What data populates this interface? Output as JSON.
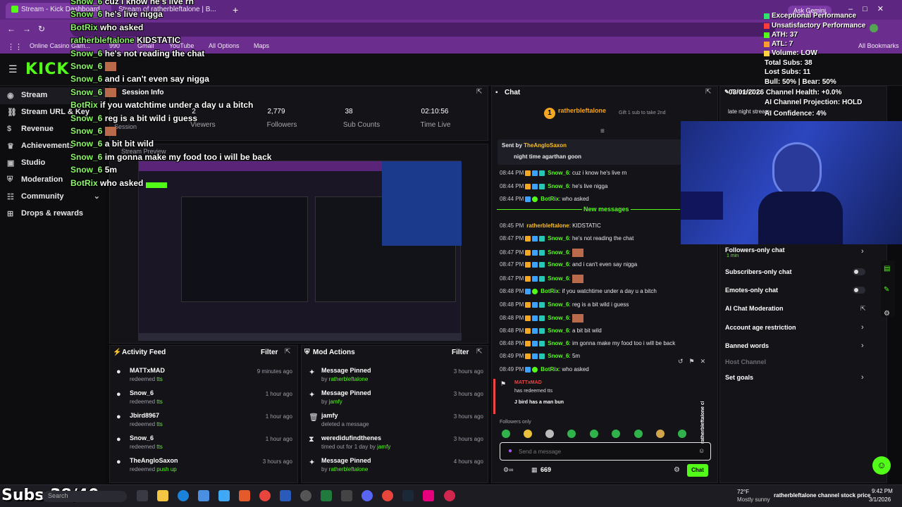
{
  "browser": {
    "tab_title": "Stream - Kick Dashboard",
    "tab2_title": "Stream of ratherbleftalone | B...",
    "ask_gemini": "Ask Gemini",
    "bookmarks": [
      "Online Casino Gam...",
      "990",
      "Gmail",
      "YouTube",
      "All Options",
      "Maps"
    ],
    "all_bookmarks": "All Bookmarks"
  },
  "sidebar": {
    "items": [
      {
        "label": "Stream",
        "icon": "broadcast-icon"
      },
      {
        "label": "Stream URL & Key",
        "icon": "link-icon"
      },
      {
        "label": "Revenue",
        "icon": "dollar-icon"
      },
      {
        "label": "Achievements",
        "icon": "trophy-icon"
      },
      {
        "label": "Studio",
        "icon": "studio-icon"
      },
      {
        "label": "Moderation",
        "icon": "shield-icon"
      },
      {
        "label": "Community",
        "icon": "community-icon"
      },
      {
        "label": "Drops & rewards",
        "icon": "gift-icon"
      }
    ]
  },
  "session": {
    "title": "Session Info",
    "stats": [
      {
        "value": "2",
        "label": "Viewers"
      },
      {
        "value": "2,779",
        "label": "Followers"
      },
      {
        "value": "38",
        "label": "Sub Counts"
      },
      {
        "value": "02:10:56",
        "label": "Time Live"
      }
    ],
    "session_label": "Session",
    "preview_label": "Stream Preview"
  },
  "activity": {
    "title": "Activity Feed",
    "filter": "Filter",
    "items": [
      {
        "name": "MATTxMAD",
        "action": "redeemed",
        "what": "tts",
        "time": "9 minutes ago"
      },
      {
        "name": "Snow_6",
        "action": "redeemed",
        "what": "tts",
        "time": "1 hour ago"
      },
      {
        "name": "Jbird8967",
        "action": "redeemed",
        "what": "tts",
        "time": "1 hour ago"
      },
      {
        "name": "Snow_6",
        "action": "redeemed",
        "what": "tts",
        "time": "1 hour ago"
      },
      {
        "name": "TheAngloSaxon",
        "action": "redeemed",
        "what": "push up",
        "time": "3 hours ago"
      }
    ]
  },
  "mod_actions": {
    "title": "Mod Actions",
    "filter": "Filter",
    "items": [
      {
        "title": "Message Pinned",
        "by": "by",
        "who": "ratherbleftalone",
        "time": "3 hours ago",
        "icon": "pin-icon"
      },
      {
        "title": "Message Pinned",
        "by": "by",
        "who": "jamfy",
        "time": "3 hours ago",
        "icon": "pin-icon"
      },
      {
        "title": "jamfy",
        "by": "deleted a message",
        "who": "",
        "time": "3 hours ago",
        "icon": "trash-icon"
      },
      {
        "title": "weredidufindthenes",
        "by": "timed out for 1 day by",
        "who": "jamfy",
        "time": "3 hours ago",
        "icon": "hourglass-icon"
      },
      {
        "title": "Message Pinned",
        "by": "by",
        "who": "ratherbleftalone",
        "time": "4 hours ago",
        "icon": "pin-icon"
      }
    ]
  },
  "chat": {
    "title": "Chat",
    "streamer": "ratherbleftalone",
    "gift_text": "Gift 1 sub to take 2nd",
    "sent_by": "Sent by",
    "sent_user": "TheAngloSaxon",
    "pinned": "night time agarthan goon",
    "new_messages": "New messages",
    "messages": [
      {
        "time": "08:44 PM",
        "user": "Snow_6",
        "text": "cuz i know he's live rn",
        "kind": "snow"
      },
      {
        "time": "08:44 PM",
        "user": "Snow_6",
        "text": "he's live nigga",
        "kind": "snow"
      },
      {
        "time": "08:44 PM",
        "user": "BotRix",
        "text": "who asked",
        "kind": "bot"
      },
      {
        "time": "08:45 PM",
        "user": "ratherbleftalone",
        "text": "KIDSTATIC",
        "kind": "rath"
      },
      {
        "time": "08:47 PM",
        "user": "Snow_6",
        "text": "he's not reading the chat",
        "kind": "snow"
      },
      {
        "time": "08:47 PM",
        "user": "Snow_6",
        "text": "",
        "kind": "snow"
      },
      {
        "time": "08:47 PM",
        "user": "Snow_6",
        "text": "and i can't even say nigga",
        "kind": "snow"
      },
      {
        "time": "08:47 PM",
        "user": "Snow_6",
        "text": "",
        "kind": "snow"
      },
      {
        "time": "08:48 PM",
        "user": "BotRix",
        "text": "if you watchtime under a day u a bitch",
        "kind": "bot"
      },
      {
        "time": "08:48 PM",
        "user": "Snow_6",
        "text": "reg is a bit wild i guess",
        "kind": "snow"
      },
      {
        "time": "08:48 PM",
        "user": "Snow_6",
        "text": "",
        "kind": "snow"
      },
      {
        "time": "08:48 PM",
        "user": "Snow_6",
        "text": "a bit bit wild",
        "kind": "snow"
      },
      {
        "time": "08:48 PM",
        "user": "Snow_6",
        "text": "im gonna make my food too i will be back",
        "kind": "snow"
      },
      {
        "time": "08:49 PM",
        "user": "Snow_6",
        "text": "5m",
        "kind": "snow"
      },
      {
        "time": "08:49 PM",
        "user": "BotRix",
        "text": "who asked",
        "kind": "bot"
      }
    ],
    "redeem_user": "MATTxMAD",
    "redeem_text": "has redeemed tts",
    "redeem_msg": "J bird has a man bun",
    "followers_only": "Followers only",
    "input_placeholder": "Send a message",
    "points": "669",
    "chat_button": "Chat"
  },
  "stream_info": {
    "title": "Stream info",
    "title_text": "late night stream",
    "settings": [
      {
        "label": "Followers-only chat",
        "sub": "1 min",
        "control": "chevron"
      },
      {
        "label": "Subscribers-only chat",
        "control": "toggle"
      },
      {
        "label": "Emotes-only chat",
        "control": "toggle"
      },
      {
        "label": "AI Chat Moderation",
        "control": "link"
      },
      {
        "label": "Account age restriction",
        "control": "chevron"
      },
      {
        "label": "Banned words",
        "control": "chevron"
      },
      {
        "label": "Host Channel",
        "control": "none"
      },
      {
        "label": "Set goals",
        "control": "chevron"
      }
    ]
  },
  "overlay_stats": {
    "lines": [
      "Exceptional Performance",
      "Unsatisfactory Performance",
      "ATH: 37",
      "ATL: 7",
      "Volume: LOW",
      "Total Subs: 38",
      "Lost Subs: 11",
      "Bull: 50% | Bear: 50%",
      "03/01/2026 Channel Health: +0.0%",
      "AI Channel Projection: HOLD",
      "AI Confidence: 4%"
    ],
    "colors": [
      "#2fe36a",
      "#ff3b3b",
      "#53fc18",
      "#ff9a2e",
      "#ffd23f"
    ]
  },
  "overlay_chat": [
    {
      "user": "Snow_6",
      "text": "cuz i know he's live rn"
    },
    {
      "user": "Snow_6",
      "text": "he's live nigga"
    },
    {
      "user": "BotRix",
      "text": "who asked"
    },
    {
      "user": "ratherbleftalone",
      "text": "KIDSTATIC"
    },
    {
      "user": "Snow_6",
      "text": "he's not reading the chat"
    },
    {
      "user": "Snow_6",
      "text": ""
    },
    {
      "user": "Snow_6",
      "text": "and i can't even say nigga"
    },
    {
      "user": "Snow_6",
      "text": ""
    },
    {
      "user": "BotRix",
      "text": "if you watchtime under a day u a bitch"
    },
    {
      "user": "Snow_6",
      "text": "reg is a bit wild i guess"
    },
    {
      "user": "Snow_6",
      "text": ""
    },
    {
      "user": "Snow_6",
      "text": "a bit bit wild"
    },
    {
      "user": "Snow_6",
      "text": "im gonna make my food too i will be back"
    },
    {
      "user": "Snow_6",
      "text": "5m"
    },
    {
      "user": "BotRix",
      "text": "who asked"
    }
  ],
  "stock_history_label": "ratherbleftalone channel stock price history",
  "taskbar": {
    "subs_overlay": "Subs:38/40",
    "search": "Search",
    "weather_temp": "72°F",
    "weather_desc": "Mostly sunny",
    "ticker": "ratherbleftalone channel stock price",
    "time": "9:42 PM",
    "date": "3/1/2026"
  }
}
